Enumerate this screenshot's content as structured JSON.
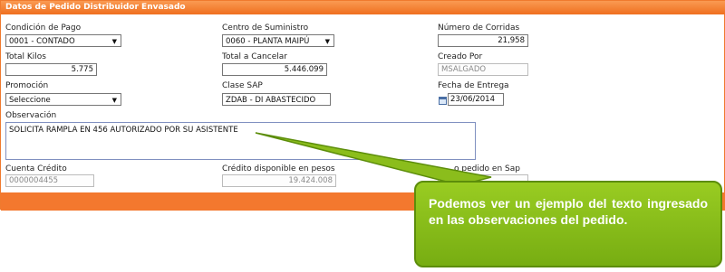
{
  "panel": {
    "title": "Datos de Pedido Distribuidor Envasado"
  },
  "fields": {
    "condicion_pago": {
      "label": "Condición de Pago",
      "value": "0001 - CONTADO"
    },
    "centro_suministro": {
      "label": "Centro de Suministro",
      "value": "0060 - PLANTA MAIPÚ"
    },
    "numero_corridas": {
      "label": "Número de Corridas",
      "value": "21,958"
    },
    "total_kilos": {
      "label": "Total Kilos",
      "value": "5.775"
    },
    "total_cancelar": {
      "label": "Total a Cancelar",
      "value": "5.446.099"
    },
    "creado_por": {
      "label": "Creado Por",
      "value": "MSALGADO"
    },
    "promocion": {
      "label": "Promoción",
      "value": "Seleccione"
    },
    "clase_sap": {
      "label": "Clase SAP",
      "value": "ZDAB - DI ABASTECIDO"
    },
    "fecha_entrega": {
      "label": "Fecha de Entrega",
      "value": "23/06/2014"
    },
    "observacion": {
      "label": "Observación",
      "value": "SOLICITA RAMPLA  EN 456 AUTORIZADO POR SU ASISTENTE"
    },
    "cuenta_credito": {
      "label": "Cuenta Crédito",
      "value": "0000004455"
    },
    "credito_disponible": {
      "label": "Crédito disponible en pesos",
      "value": "19.424.008"
    },
    "pedido_sap": {
      "label_visible": "o pedido en Sap"
    }
  },
  "callout": {
    "text": "Podemos ver un ejemplo del texto ingresado en las observaciones del pedido."
  },
  "colors": {
    "header": "#f07a2e",
    "callout_green": "#88bb1a",
    "callout_border": "#5c8d0a"
  },
  "icons": {
    "dropdown": "▼",
    "calendar": "calendar-icon"
  }
}
